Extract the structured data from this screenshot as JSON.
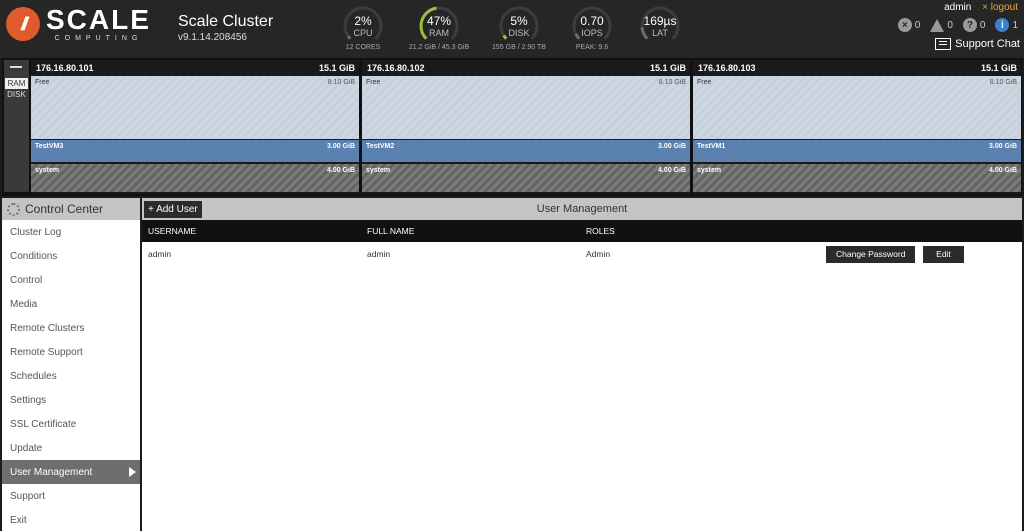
{
  "brand": {
    "logo_mark": "//",
    "logo_word": "SCALE",
    "logo_sub": "COMPUTING"
  },
  "cluster": {
    "name": "Scale Cluster",
    "version": "v9.1.14.208456"
  },
  "gauges": [
    {
      "id": "cpu",
      "value": "2%",
      "label": "CPU",
      "sub": "12 CORES",
      "level": 0.02,
      "color": "#6a6a6a"
    },
    {
      "id": "ram",
      "value": "47%",
      "label": "RAM",
      "sub": "21.2 GiB / 45.3 GiB",
      "level": 0.47,
      "color": "#9bbf3a"
    },
    {
      "id": "disk",
      "value": "5%",
      "label": "DISK",
      "sub": "155 GB / 2.90 TB",
      "level": 0.05,
      "color": "#9bbf3a"
    },
    {
      "id": "iops",
      "value": "0.70",
      "label": "IOPS",
      "sub": "PEAK: 9.6",
      "level": 0.07,
      "color": "#6a6a6a"
    },
    {
      "id": "lat",
      "value": "169µs",
      "label": "LAT",
      "sub": "",
      "level": 0.15,
      "color": "#6a6a6a"
    }
  ],
  "user": {
    "name": "admin",
    "logout": "× logout"
  },
  "alerts": {
    "errors": "0",
    "warnings": "0",
    "questions": "0",
    "info": "1",
    "support_chat": "Support Chat"
  },
  "toggle": {
    "ram": "RAM",
    "disk": "DISK"
  },
  "nodes": [
    {
      "ip": "176.16.80.101",
      "total": "15.1 GiB",
      "free_label": "Free",
      "free": "8.10 GiB",
      "vm_name": "TestVM3",
      "vm_size": "3.00 GiB",
      "system_label": "system",
      "system_size": "4.00 GiB"
    },
    {
      "ip": "176.16.80.102",
      "total": "15.1 GiB",
      "free_label": "Free",
      "free": "8.10 GiB",
      "vm_name": "TestVM2",
      "vm_size": "3.00 GiB",
      "system_label": "system",
      "system_size": "4.00 GiB"
    },
    {
      "ip": "176.16.80.103",
      "total": "15.1 GiB",
      "free_label": "Free",
      "free": "8.10 GiB",
      "vm_name": "TestVM1",
      "vm_size": "3.00 GiB",
      "system_label": "system",
      "system_size": "4.00 GiB"
    }
  ],
  "sidebar": {
    "title": "Control Center",
    "items": [
      {
        "label": "Cluster Log"
      },
      {
        "label": "Conditions"
      },
      {
        "label": "Control"
      },
      {
        "label": "Media"
      },
      {
        "label": "Remote Clusters"
      },
      {
        "label": "Remote Support"
      },
      {
        "label": "Schedules"
      },
      {
        "label": "Settings"
      },
      {
        "label": "SSL Certificate"
      },
      {
        "label": "Update"
      },
      {
        "label": "User Management",
        "active": true
      },
      {
        "label": "Support"
      },
      {
        "label": "Exit"
      }
    ]
  },
  "main": {
    "title": "User Management",
    "add_user": "+ Add User",
    "columns": {
      "username": "USERNAME",
      "full_name": "FULL NAME",
      "roles": "ROLES"
    },
    "rows": [
      {
        "username": "admin",
        "full_name": "admin",
        "roles": "Admin",
        "change_password": "Change Password",
        "edit": "Edit"
      }
    ]
  }
}
